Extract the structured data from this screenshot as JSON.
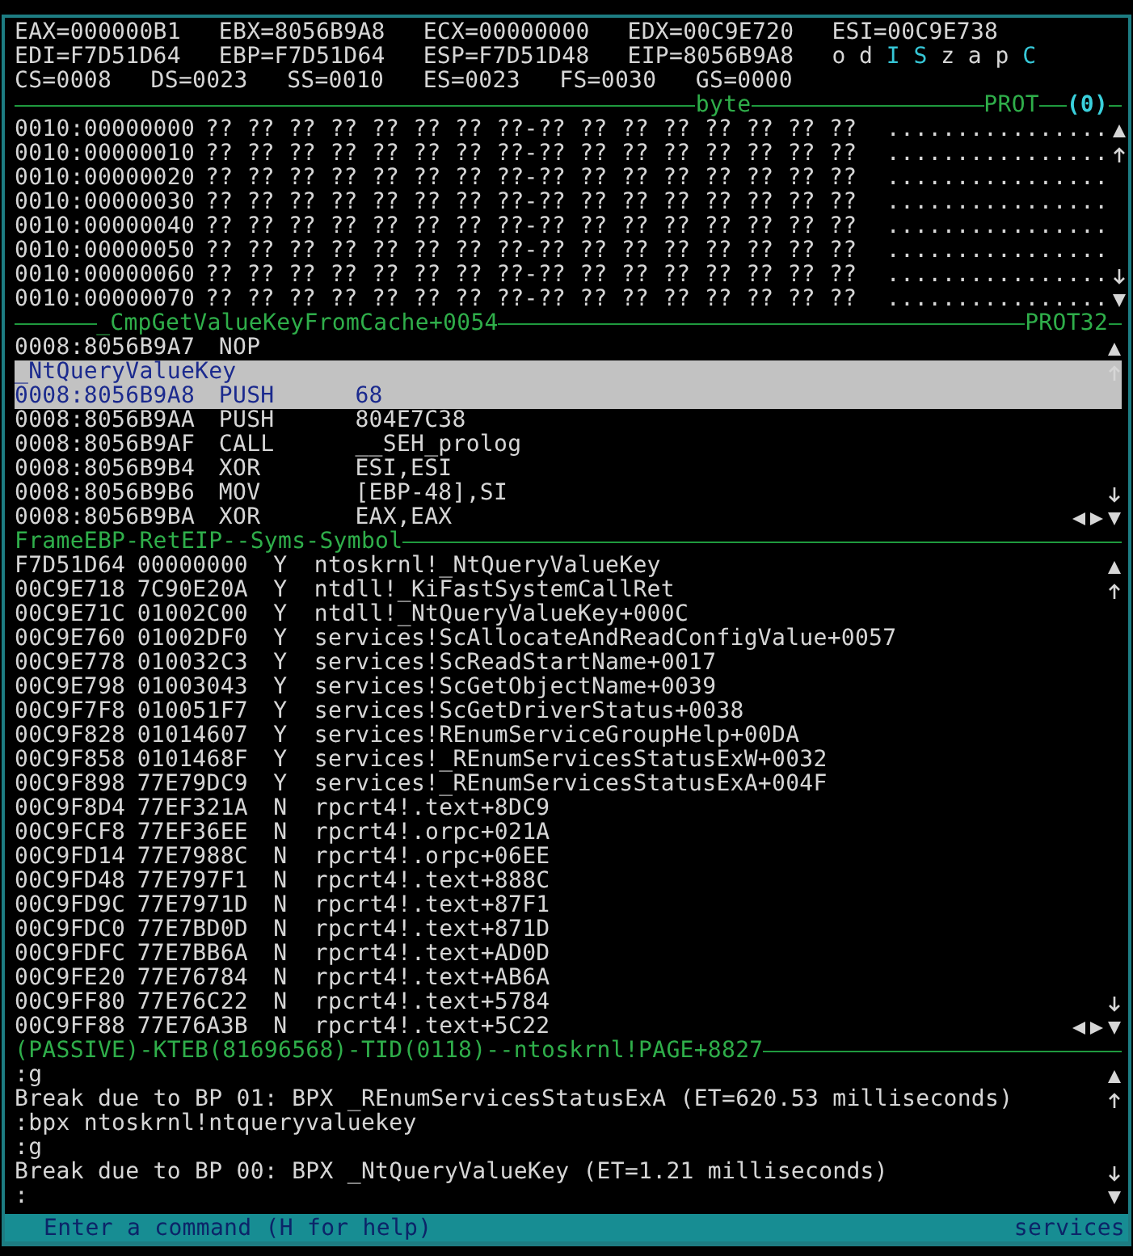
{
  "registers": {
    "general": [
      [
        "EAX=000000B1",
        "EBX=8056B9A8",
        "ECX=00000000",
        "EDX=00C9E720",
        "ESI=00C9E738"
      ],
      [
        "EDI=F7D51D64",
        "EBP=F7D51D64",
        "ESP=F7D51D48",
        "EIP=8056B9A8"
      ]
    ],
    "segments": [
      "CS=0008",
      "DS=0023",
      "SS=0010",
      "ES=0023",
      "FS=0030",
      "GS=0000"
    ],
    "flags": [
      {
        "letter": "o",
        "set": false
      },
      {
        "letter": "d",
        "set": false
      },
      {
        "letter": "I",
        "set": true
      },
      {
        "letter": "S",
        "set": true
      },
      {
        "letter": "z",
        "set": false
      },
      {
        "letter": "a",
        "set": false
      },
      {
        "letter": "p",
        "set": false
      },
      {
        "letter": "C",
        "set": true
      }
    ]
  },
  "data_window": {
    "format": "byte",
    "mode": "PROT",
    "index": "(0)",
    "rows": [
      {
        "address": "0010:00000000",
        "bytes": "?? ?? ?? ?? ?? ?? ?? ??-?? ?? ?? ?? ?? ?? ?? ??",
        "ascii": "................"
      },
      {
        "address": "0010:00000010",
        "bytes": "?? ?? ?? ?? ?? ?? ?? ??-?? ?? ?? ?? ?? ?? ?? ??",
        "ascii": "................"
      },
      {
        "address": "0010:00000020",
        "bytes": "?? ?? ?? ?? ?? ?? ?? ??-?? ?? ?? ?? ?? ?? ?? ??",
        "ascii": "................"
      },
      {
        "address": "0010:00000030",
        "bytes": "?? ?? ?? ?? ?? ?? ?? ??-?? ?? ?? ?? ?? ?? ?? ??",
        "ascii": "................"
      },
      {
        "address": "0010:00000040",
        "bytes": "?? ?? ?? ?? ?? ?? ?? ??-?? ?? ?? ?? ?? ?? ?? ??",
        "ascii": "................"
      },
      {
        "address": "0010:00000050",
        "bytes": "?? ?? ?? ?? ?? ?? ?? ??-?? ?? ?? ?? ?? ?? ?? ??",
        "ascii": "................"
      },
      {
        "address": "0010:00000060",
        "bytes": "?? ?? ?? ?? ?? ?? ?? ??-?? ?? ?? ?? ?? ?? ?? ??",
        "ascii": "................"
      },
      {
        "address": "0010:00000070",
        "bytes": "?? ?? ?? ?? ?? ?? ?? ??-?? ?? ?? ?? ?? ?? ?? ??",
        "ascii": "................"
      }
    ]
  },
  "code_window": {
    "title": "_CmpGetValueKeyFromCache+0054",
    "mode": "PROT32",
    "lines": [
      {
        "kind": "instruction",
        "address": "0008:8056B9A7",
        "mnemonic": "NOP",
        "selected": false
      },
      {
        "kind": "label",
        "text": "_NtQueryValueKey",
        "selected": true
      },
      {
        "kind": "instruction",
        "address": "0008:8056B9A8",
        "mnemonic": "PUSH",
        "operands": "68",
        "selected": true
      },
      {
        "kind": "instruction",
        "address": "0008:8056B9AA",
        "mnemonic": "PUSH",
        "operands": "804E7C38",
        "selected": false
      },
      {
        "kind": "instruction",
        "address": "0008:8056B9AF",
        "mnemonic": "CALL",
        "operands": "__SEH_prolog",
        "selected": false
      },
      {
        "kind": "instruction",
        "address": "0008:8056B9B4",
        "mnemonic": "XOR",
        "operands": "ESI,ESI",
        "selected": false
      },
      {
        "kind": "instruction",
        "address": "0008:8056B9B6",
        "mnemonic": "MOV",
        "operands": "[EBP-48],SI",
        "selected": false
      },
      {
        "kind": "instruction",
        "address": "0008:8056B9BA",
        "mnemonic": "XOR",
        "operands": "EAX,EAX",
        "selected": false
      }
    ]
  },
  "stack_window": {
    "header": "FrameEBP-RetEIP--Syms-Symbol",
    "rows": [
      {
        "frame": "F7D51D64",
        "ret": "00000000",
        "syms": "Y",
        "symbol": "ntoskrnl!_NtQueryValueKey"
      },
      {
        "frame": "00C9E718",
        "ret": "7C90E20A",
        "syms": "Y",
        "symbol": "ntdll!_KiFastSystemCallRet"
      },
      {
        "frame": "00C9E71C",
        "ret": "01002C00",
        "syms": "Y",
        "symbol": "ntdll!_NtQueryValueKey+000C"
      },
      {
        "frame": "00C9E760",
        "ret": "01002DF0",
        "syms": "Y",
        "symbol": "services!ScAllocateAndReadConfigValue+0057"
      },
      {
        "frame": "00C9E778",
        "ret": "010032C3",
        "syms": "Y",
        "symbol": "services!ScReadStartName+0017"
      },
      {
        "frame": "00C9E798",
        "ret": "01003043",
        "syms": "Y",
        "symbol": "services!ScGetObjectName+0039"
      },
      {
        "frame": "00C9F7F8",
        "ret": "010051F7",
        "syms": "Y",
        "symbol": "services!ScGetDriverStatus+0038"
      },
      {
        "frame": "00C9F828",
        "ret": "01014607",
        "syms": "Y",
        "symbol": "services!REnumServiceGroupHelp+00DA"
      },
      {
        "frame": "00C9F858",
        "ret": "0101468F",
        "syms": "Y",
        "symbol": "services!_REnumServicesStatusExW+0032"
      },
      {
        "frame": "00C9F898",
        "ret": "77E79DC9",
        "syms": "Y",
        "symbol": "services!_REnumServicesStatusExA+004F"
      },
      {
        "frame": "00C9F8D4",
        "ret": "77EF321A",
        "syms": "N",
        "symbol": "rpcrt4!.text+8DC9"
      },
      {
        "frame": "00C9FCF8",
        "ret": "77EF36EE",
        "syms": "N",
        "symbol": "rpcrt4!.orpc+021A"
      },
      {
        "frame": "00C9FD14",
        "ret": "77E7988C",
        "syms": "N",
        "symbol": "rpcrt4!.orpc+06EE"
      },
      {
        "frame": "00C9FD48",
        "ret": "77E797F1",
        "syms": "N",
        "symbol": "rpcrt4!.text+888C"
      },
      {
        "frame": "00C9FD9C",
        "ret": "77E7971D",
        "syms": "N",
        "symbol": "rpcrt4!.text+87F1"
      },
      {
        "frame": "00C9FDC0",
        "ret": "77E7BD0D",
        "syms": "N",
        "symbol": "rpcrt4!.text+871D"
      },
      {
        "frame": "00C9FDFC",
        "ret": "77E7BB6A",
        "syms": "N",
        "symbol": "rpcrt4!.text+AD0D"
      },
      {
        "frame": "00C9FE20",
        "ret": "77E76784",
        "syms": "N",
        "symbol": "rpcrt4!.text+AB6A"
      },
      {
        "frame": "00C9FF80",
        "ret": "77E76C22",
        "syms": "N",
        "symbol": "rpcrt4!.text+5784"
      },
      {
        "frame": "00C9FF88",
        "ret": "77E76A3B",
        "syms": "N",
        "symbol": "rpcrt4!.text+5C22"
      }
    ]
  },
  "thread_status": "(PASSIVE)-KTEB(81696568)-TID(0118)--ntoskrnl!PAGE+8827",
  "console": {
    "lines": [
      ":g",
      "Break due to BP 01: BPX _REnumServicesStatusExA (ET=620.53 milliseconds)",
      ":bpx ntoskrnl!ntqueryvaluekey",
      ":g",
      "Break due to BP 00: BPX _NtQueryValueKey (ET=1.21 milliseconds)",
      ":"
    ]
  },
  "status_bar": {
    "hint": "Enter a command (H for help)",
    "module": "services"
  }
}
